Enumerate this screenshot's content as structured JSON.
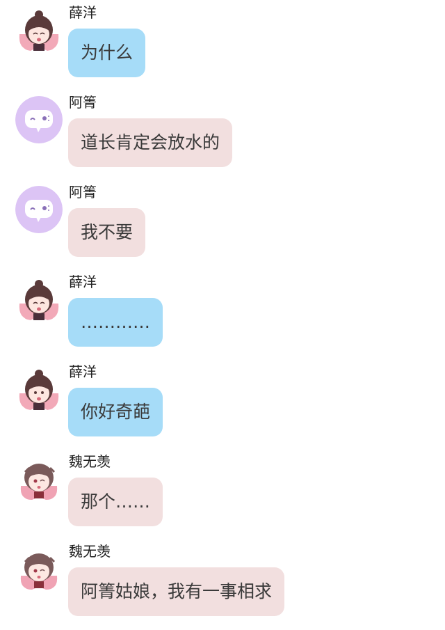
{
  "colors": {
    "blue_bubble": "#a6dcf8",
    "pink_bubble": "#f2dfdf",
    "bot_avatar_bg": "#dcc4f5",
    "text": "#3a3a3a"
  },
  "messages": [
    {
      "sender": "薛洋",
      "text": "为什么",
      "bubble": "blue",
      "avatar": "xueyang-avatar"
    },
    {
      "sender": "阿箐",
      "text": "道长肯定会放水的",
      "bubble": "pink",
      "avatar": "chat-bubble-icon"
    },
    {
      "sender": "阿箐",
      "text": "我不要",
      "bubble": "pink",
      "avatar": "chat-bubble-icon"
    },
    {
      "sender": "薛洋",
      "text": "…………",
      "bubble": "blue",
      "avatar": "xueyang-avatar"
    },
    {
      "sender": "薛洋",
      "text": "你好奇葩",
      "bubble": "blue",
      "avatar": "xueyang-avatar"
    },
    {
      "sender": "魏无羡",
      "text": "那个……",
      "bubble": "pink",
      "avatar": "weiwuxian-avatar"
    },
    {
      "sender": "魏无羡",
      "text": "阿箐姑娘，我有一事相求",
      "bubble": "pink",
      "avatar": "weiwuxian-avatar"
    }
  ]
}
